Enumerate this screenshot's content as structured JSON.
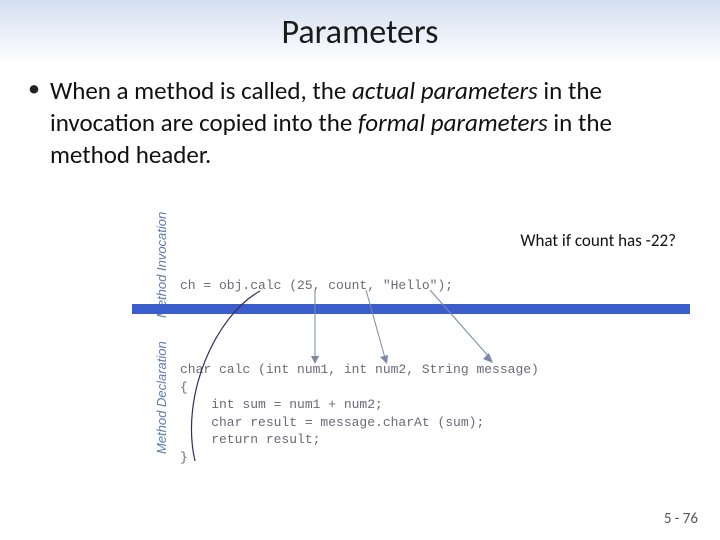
{
  "title": "Parameters",
  "bullet": {
    "pre": "When a method is called, the ",
    "em1": "actual parameters",
    "mid": " in the invocation are copied into the ",
    "em2": "formal parameters",
    "post": " in the method header."
  },
  "annotation": "What if count has -22?",
  "labels": {
    "invocation": "Method\nInvocation",
    "declaration": "Method\nDeclaration"
  },
  "code": {
    "invoke": "ch = obj.calc (25, count, \"Hello\");",
    "decl": "char calc (int num1, int num2, String message)\n{\n    int sum = num1 + num2;\n    char result = message.charAt (sum);\n    return result;\n}"
  },
  "page": "5 - 76"
}
